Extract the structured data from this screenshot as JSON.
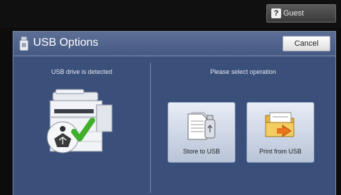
{
  "topbar": {
    "user_label": "Guest",
    "user_icon": "key-icon"
  },
  "panel": {
    "title": "USB Options",
    "cancel_label": "Cancel",
    "status_text": "USB drive is detected",
    "prompt_text": "Please select operation"
  },
  "operations": [
    {
      "label": "Store to USB",
      "icon": "store-to-usb-icon"
    },
    {
      "label": "Print from USB",
      "icon": "print-from-usb-icon"
    }
  ],
  "colors": {
    "panel_bg": "#3a4f79",
    "header_bg": "#4f6390",
    "button_bg": "#dce3ef",
    "accent_check": "#3fae2a"
  }
}
